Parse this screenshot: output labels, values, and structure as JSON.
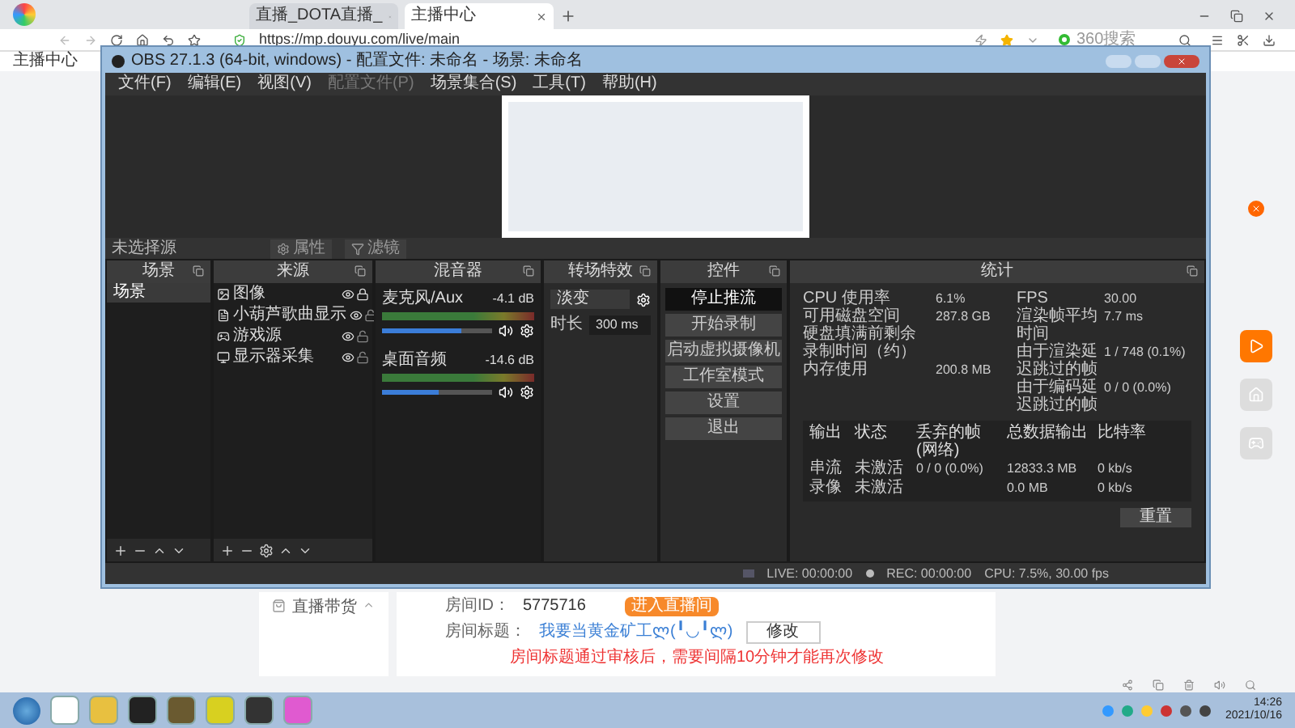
{
  "browser": {
    "tabs": [
      {
        "label": "直播_DOTA直播_",
        "selected": false
      },
      {
        "label": "主播中心",
        "selected": true
      }
    ],
    "url": "https://mp.douyu.com/live/main",
    "search": {
      "placeholder": "360搜索"
    },
    "bookmarks": [
      "主播中心"
    ]
  },
  "obs": {
    "title": "OBS 27.1.3 (64-bit, windows) - 配置文件: 未命名 - 场景: 未命名",
    "menu": [
      {
        "label": "文件(F)",
        "disabled": false
      },
      {
        "label": "编辑(E)",
        "disabled": false
      },
      {
        "label": "视图(V)",
        "disabled": false
      },
      {
        "label": "配置文件(P)",
        "disabled": true
      },
      {
        "label": "场景集合(S)",
        "disabled": false
      },
      {
        "label": "工具(T)",
        "disabled": false
      },
      {
        "label": "帮助(H)",
        "disabled": false
      }
    ],
    "source_toolbar": {
      "label": "未选择源",
      "properties": "属性",
      "filters": "滤镜"
    },
    "scenes": {
      "title": "场景",
      "items": [
        {
          "label": "场景",
          "selected": true
        }
      ]
    },
    "sources": {
      "title": "来源",
      "items": [
        {
          "label": "图像",
          "kind": "image",
          "visible": true,
          "locked": true
        },
        {
          "label": "小葫芦歌曲显示",
          "kind": "text",
          "visible": true,
          "locked": false
        },
        {
          "label": "游戏源",
          "kind": "game",
          "visible": true,
          "locked": false
        },
        {
          "label": "显示器采集",
          "kind": "display",
          "visible": true,
          "locked": false
        }
      ]
    },
    "mixer": {
      "title": "混音器",
      "channels": [
        {
          "name": "麦克风/Aux",
          "reading": "-4.1 dB",
          "level": 0.72,
          "muted": false
        },
        {
          "name": "桌面音频",
          "reading": "-14.6 dB",
          "level": 0.52,
          "muted": false
        }
      ]
    },
    "transitions": {
      "title": "转场特效",
      "selected": "淡变",
      "duration_label": "时长",
      "duration": "300 ms"
    },
    "controls": {
      "title": "控件",
      "buttons": [
        {
          "label": "停止推流",
          "active": true
        },
        {
          "label": "开始录制",
          "active": false
        },
        {
          "label": "启动虚拟摄像机",
          "active": false
        },
        {
          "label": "工作室模式",
          "active": false
        },
        {
          "label": "设置",
          "active": false
        },
        {
          "label": "退出",
          "active": false
        }
      ]
    },
    "stats": {
      "title": "统计",
      "left": [
        {
          "label": "CPU 使用率",
          "value": "6.1%"
        },
        {
          "label": "可用磁盘空间",
          "value": "287.8 GB"
        },
        {
          "label": "硬盘填满前剩余录制时间（约）"
        },
        {
          "label": "内存使用",
          "value": "200.8 MB"
        }
      ],
      "right": [
        {
          "label": "FPS",
          "value": "30.00"
        },
        {
          "label": "渲染帧平均时间",
          "value": "7.7 ms"
        },
        {
          "label": "由于渲染延迟跳过的帧",
          "value": "1 / 748 (0.1%)"
        },
        {
          "label": "由于编码延迟跳过的帧",
          "value": "0 / 0 (0.0%)"
        }
      ],
      "columns": [
        "输出",
        "状态",
        "丢弃的帧(网络)",
        "总数据输出",
        "比特率"
      ],
      "outputs": [
        {
          "output": "串流",
          "status": "未激活",
          "dropped": "0 / 0 (0.0%)",
          "total": "12833.3 MB",
          "bitrate": "0 kb/s"
        },
        {
          "output": "录像",
          "status": "未激活",
          "total": "0.0 MB",
          "bitrate": "0 kb/s"
        }
      ],
      "reset": "重置"
    },
    "status": {
      "live": "LIVE: 00:00:00",
      "rec": "REC: 00:00:00",
      "cpu": "CPU: 7.5%, 30.00 fps"
    }
  },
  "page": {
    "sidebar_item": "直播带货",
    "room_id_label": "房间ID：",
    "room_id": "5775716",
    "enter_button": "进入直播间",
    "title_label": "房间标题：",
    "room_title": "我要当黄金矿工ლ(╹◡╹ლ)",
    "edit_button": "修改",
    "notice": "房间标题通过审核后，需要间隔10分钟才能再次修改"
  },
  "taskbar": {
    "time": "14:26",
    "date": "2021/10/16"
  }
}
